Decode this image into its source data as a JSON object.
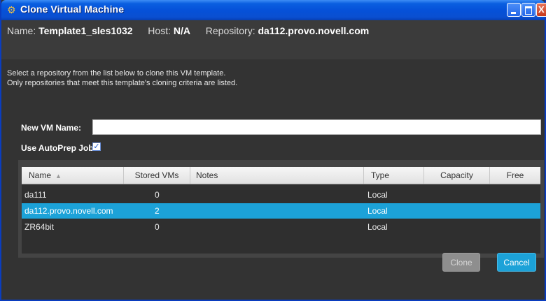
{
  "window": {
    "title": "Clone Virtual Machine"
  },
  "header": {
    "name_label": "Name:",
    "name_value": "Template1_sles1032",
    "host_label": "Host:",
    "host_value": "N/A",
    "repository_label": "Repository:",
    "repository_value": "da112.provo.novell.com"
  },
  "instructions": {
    "line1": "Select a repository from the list below to clone this VM template.",
    "line2": "Only repositories that meet this template's cloning criteria are listed."
  },
  "form": {
    "vm_name_label": "New VM Name:",
    "vm_name_value": "",
    "autoprep_label": "Use AutoPrep Job",
    "autoprep_checked": true
  },
  "grid": {
    "columns": [
      "Name",
      "Stored VMs",
      "Notes",
      "Type",
      "Capacity",
      "Free"
    ],
    "sorted_column": "Name",
    "rows": [
      {
        "name": "da111",
        "stored_vms": "0",
        "notes": "",
        "type": "Local",
        "capacity": "",
        "free": "",
        "selected": false
      },
      {
        "name": "da112.provo.novell.com",
        "stored_vms": "2",
        "notes": "",
        "type": "Local",
        "capacity": "",
        "free": "",
        "selected": true
      },
      {
        "name": "ZR64bit",
        "stored_vms": "0",
        "notes": "",
        "type": "Local",
        "capacity": "",
        "free": "",
        "selected": false
      }
    ]
  },
  "buttons": {
    "clone": "Clone",
    "cancel": "Cancel"
  },
  "colors": {
    "accent": "#1ca2d8",
    "titlebar": "#0551d9",
    "background": "#333333"
  }
}
